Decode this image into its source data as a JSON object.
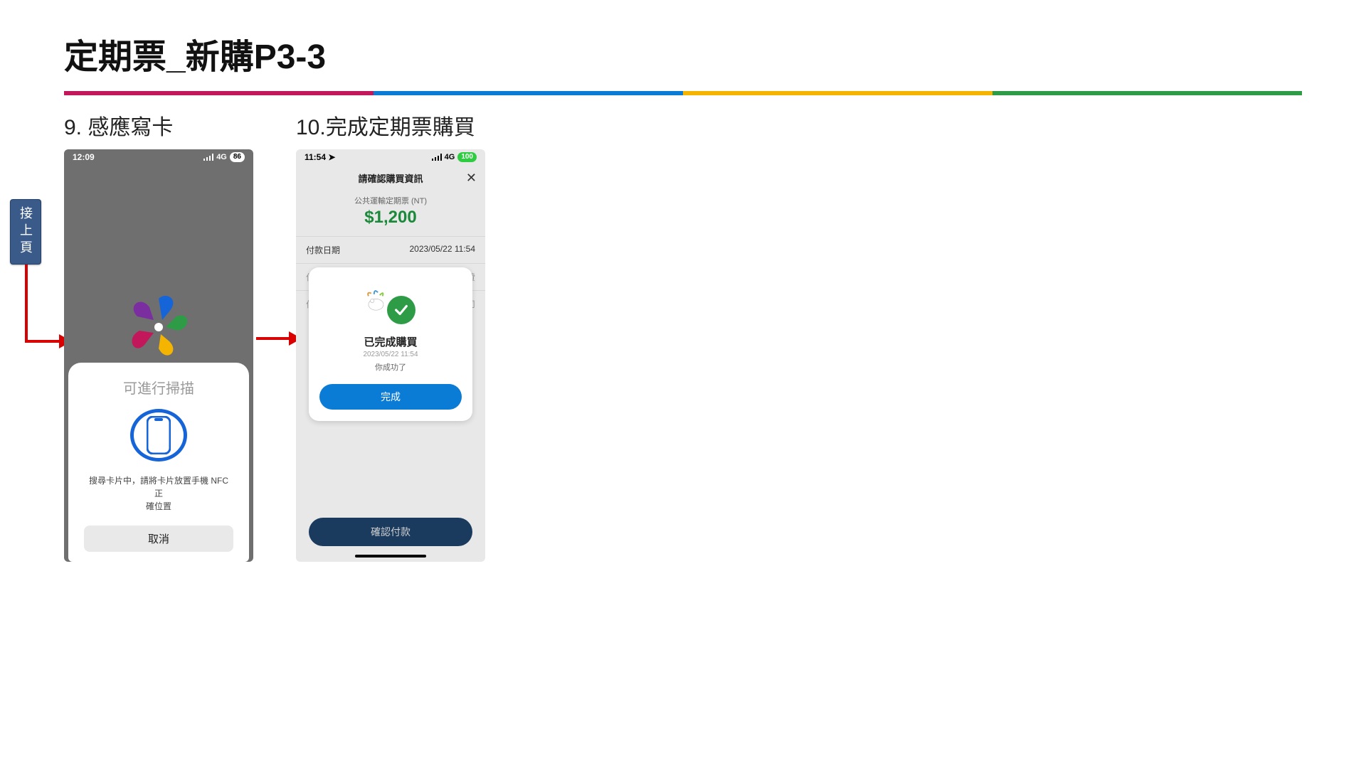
{
  "title": "定期票_新購P3-3",
  "prev_chip": "接上頁",
  "steps": {
    "s9": {
      "label": "9. 感應寫卡"
    },
    "s10": {
      "label": "10.完成定期票購買"
    }
  },
  "phone1": {
    "status_time": "12:09",
    "status_net": "4G",
    "status_batt": "86",
    "sheet_title": "可進行掃描",
    "msg_line1": "搜尋卡片中，請將卡片放置手機 NFC 正",
    "msg_line2": "確位置",
    "cancel": "取消"
  },
  "phone2": {
    "status_time": "11:54",
    "status_net": "4G",
    "status_batt": "100",
    "header_title": "請確認購買資訊",
    "sub": "公共運輸定期票 (NT)",
    "price": "$1,200",
    "pay_date_label": "付款日期",
    "pay_date_value": "2023/05/22 11:54",
    "modal_title": "已完成購買",
    "modal_timestamp": "2023/05/22 11:54",
    "modal_sub": "你成功了",
    "modal_button": "完成",
    "confirm_button": "確認付款"
  }
}
